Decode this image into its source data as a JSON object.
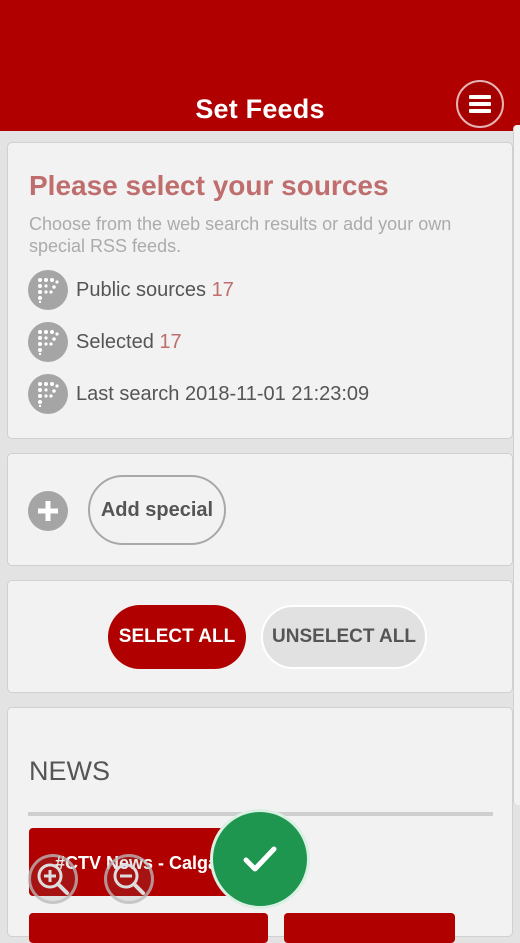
{
  "header": {
    "title": "Set Feeds",
    "menu_icon": "hamburger-menu-icon"
  },
  "sources": {
    "title": "Please select your sources",
    "subtitle": "Choose from the web search results or add your own special RSS feeds.",
    "public": {
      "label": "Public sources",
      "count": "17"
    },
    "selected": {
      "label": "Selected",
      "count": "17"
    },
    "last_search": {
      "label": "Last search",
      "value": "2018-11-01 21:23:09"
    }
  },
  "special": {
    "add_label": "Add special"
  },
  "selection": {
    "select_all": "SELECT ALL",
    "unselect_all": "UNSELECT ALL"
  },
  "news": {
    "title": "NEWS",
    "feeds": [
      "#CTV News - Calgary"
    ]
  },
  "colors": {
    "brand": "#b00000",
    "accent_text": "#bf6d6d",
    "confirm": "#1e9650"
  }
}
